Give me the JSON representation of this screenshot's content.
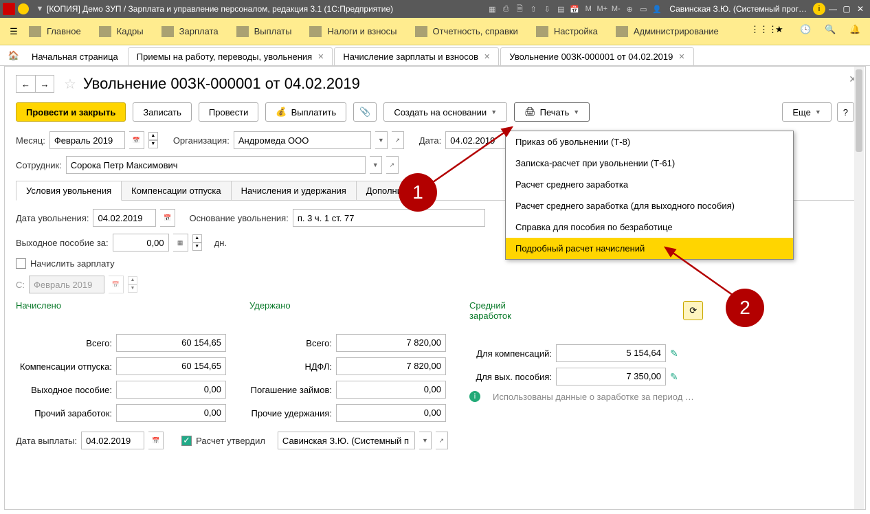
{
  "titlebar": {
    "title": "[КОПИЯ] Демо ЗУП / Зарплата и управление персоналом, редакция 3.1  (1С:Предприятие)",
    "user": "Савинская З.Ю. (Системный прог…",
    "m": "M",
    "mp": "M+",
    "mm": "M-"
  },
  "mainmenu": {
    "items": [
      "Главное",
      "Кадры",
      "Зарплата",
      "Выплаты",
      "Налоги и взносы",
      "Отчетность, справки",
      "Настройка",
      "Администрирование"
    ]
  },
  "tabs": {
    "home": "Начальная страница",
    "t1": "Приемы на работу, переводы, увольнения",
    "t2": "Начисление зарплаты и взносов",
    "t3": "Увольнение 00ЗК-000001 от 04.02.2019"
  },
  "page": {
    "title": "Увольнение 00ЗК-000001 от 04.02.2019",
    "btn_post_close": "Провести и закрыть",
    "btn_save": "Записать",
    "btn_post": "Провести",
    "btn_pay": "Выплатить",
    "btn_create": "Создать на основании",
    "btn_print": "Печать",
    "btn_more": "Еще",
    "btn_help": "?",
    "lbl_month": "Месяц:",
    "val_month": "Февраль 2019",
    "lbl_org": "Организация:",
    "val_org": "Андромеда ООО",
    "lbl_date": "Дата:",
    "val_date": "04.02.2019",
    "lbl_emp": "Сотрудник:",
    "val_emp": "Сорока Петр Максимович",
    "itabs": [
      "Условия увольнения",
      "Компенсации отпуска",
      "Начисления и удержания",
      "Дополнитель"
    ],
    "lbl_dismiss_date": "Дата увольнения:",
    "val_dismiss_date": "04.02.2019",
    "lbl_reason": "Основание увольнения:",
    "val_reason": "п. 3 ч. 1 ст. 77",
    "lbl_sev": "Выходное пособие за:",
    "val_sev": "0,00",
    "lbl_days": "дн.",
    "chk_salary": "Начислить зарплату",
    "lbl_from": "С:",
    "val_from": "Февраль 2019",
    "hdr_accrued": "Начислено",
    "hdr_withheld": "Удержано",
    "hdr_avg": "Средний заработок",
    "accrued": {
      "lbl_total": "Всего:",
      "val_total": "60 154,65",
      "lbl_comp": "Компенсации отпуска:",
      "val_comp": "60 154,65",
      "lbl_sev": "Выходное пособие:",
      "val_sev": "0,00",
      "lbl_other": "Прочий заработок:",
      "val_other": "0,00"
    },
    "withheld": {
      "lbl_total": "Всего:",
      "val_total": "7 820,00",
      "lbl_ndfl": "НДФЛ:",
      "val_ndfl": "7 820,00",
      "lbl_loan": "Погашение займов:",
      "val_loan": "0,00",
      "lbl_other": "Прочие удержания:",
      "val_other": "0,00"
    },
    "avg": {
      "lbl_comp": "Для компенсаций:",
      "val_comp": "5 154,64",
      "lbl_sev": "Для вых. пособия:",
      "val_sev": "7 350,00",
      "info": "Использованы данные о заработке за период …"
    },
    "lbl_paydate": "Дата выплаты:",
    "val_paydate": "04.02.2019",
    "lbl_approved": "Расчет утвердил",
    "val_approver": "Савинская З.Ю. (Системный п"
  },
  "print_menu": [
    "Приказ об увольнении (Т-8)",
    "Записка-расчет при увольнении (Т-61)",
    "Расчет среднего заработка",
    "Расчет среднего заработка (для выходного пособия)",
    "Справка для пособия по безработице",
    "Подробный расчет начислений"
  ],
  "markers": {
    "m1": "1",
    "m2": "2"
  }
}
